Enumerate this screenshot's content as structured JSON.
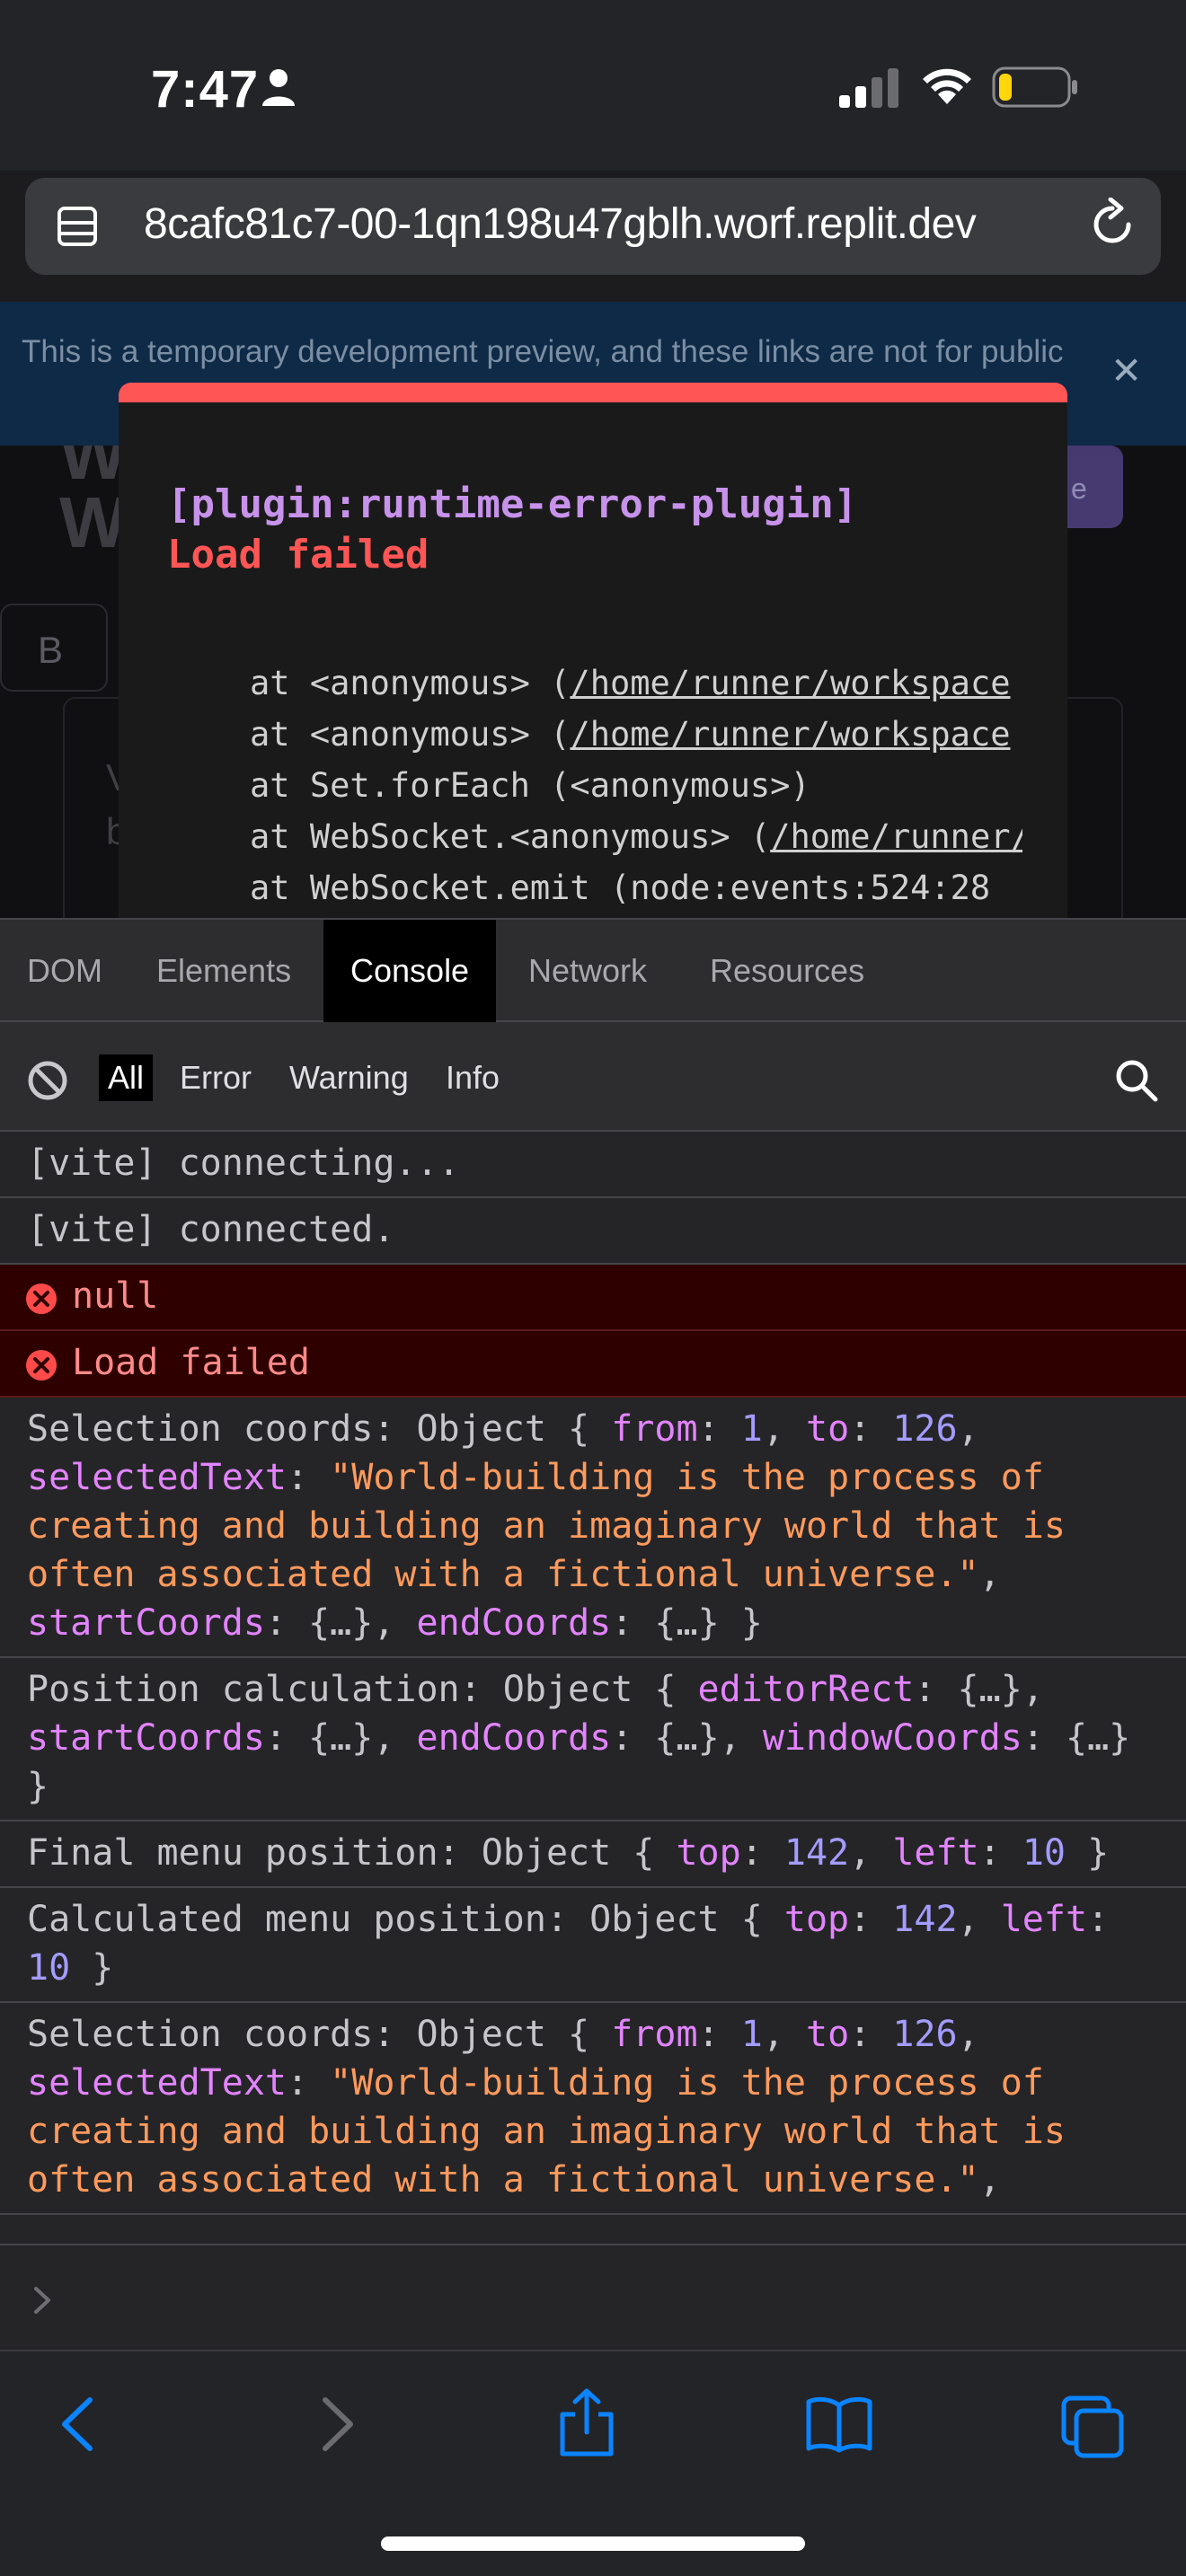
{
  "status_bar": {
    "time": "7:47",
    "battery_level": 0.2,
    "icons": [
      "person-icon",
      "cellular-signal-icon",
      "wifi-icon",
      "battery-icon"
    ]
  },
  "address_bar": {
    "url": "8cafc81c7-00-1qn198u47gblh.worf.replit.dev",
    "icons": [
      "tab-overview-icon",
      "reload-icon"
    ]
  },
  "page": {
    "banner_text": "This is a temporary development preview, and these links are not for public",
    "banner_close": "✕",
    "bg_title": "W\nW",
    "bg_button": "e",
    "bg_b": "B",
    "bg_text": "V\nb"
  },
  "error_overlay": {
    "plugin": "[plugin:runtime-error-plugin]",
    "message": "Load failed",
    "stack": [
      {
        "prefix": "at <anonymous> (",
        "link": "/home/runner/workspace",
        "suffix": ""
      },
      {
        "prefix": "at <anonymous> (",
        "link": "/home/runner/workspace",
        "suffix": ""
      },
      {
        "prefix": "at Set.forEach (<anonymous>)",
        "link": "",
        "suffix": ""
      },
      {
        "prefix": "at WebSocket.<anonymous> (",
        "link": "/home/runner/",
        "suffix": ""
      },
      {
        "prefix": "at WebSocket.emit (node:events:524:28",
        "link": "",
        "suffix": ""
      }
    ]
  },
  "devtools": {
    "tabs": [
      {
        "label": "DOM",
        "active": false
      },
      {
        "label": "Elements",
        "active": false
      },
      {
        "label": "Console",
        "active": true
      },
      {
        "label": "Network",
        "active": false
      },
      {
        "label": "Resources",
        "active": false
      }
    ],
    "filters": [
      {
        "label": "All",
        "active": true
      },
      {
        "label": "Error",
        "active": false
      },
      {
        "label": "Warning",
        "active": false
      },
      {
        "label": "Info",
        "active": false
      }
    ]
  },
  "console_messages": [
    {
      "level": "log",
      "text": "[vite] connecting..."
    },
    {
      "level": "log",
      "text": "[vite] connected."
    },
    {
      "level": "error",
      "text": "null"
    },
    {
      "level": "error",
      "text": "Load failed"
    },
    {
      "level": "log",
      "label": "Selection coords: Object { ",
      "props": [
        {
          "key": "from",
          "value": "1",
          "kind": "n"
        },
        {
          "key": "to",
          "value": "126",
          "kind": "n"
        },
        {
          "key": "selectedText",
          "value": "\"World-building is the process of creating and building an imaginary world that is often associated with a fictional universe.\"",
          "kind": "s"
        },
        {
          "key": "startCoords",
          "value": "{…}",
          "kind": "o"
        },
        {
          "key": "endCoords",
          "value": "{…}",
          "kind": "o"
        }
      ],
      "close": " }"
    },
    {
      "level": "log",
      "label": "Position calculation: Object { ",
      "props": [
        {
          "key": "editorRect",
          "value": "{…}",
          "kind": "o"
        },
        {
          "key": "startCoords",
          "value": "{…}",
          "kind": "o"
        },
        {
          "key": "endCoords",
          "value": "{…}",
          "kind": "o"
        },
        {
          "key": "windowCoords",
          "value": "{…}",
          "kind": "o"
        }
      ],
      "close": " }"
    },
    {
      "level": "log",
      "label": "Final menu position: Object { ",
      "props": [
        {
          "key": "top",
          "value": "142",
          "kind": "n"
        },
        {
          "key": "left",
          "value": "10",
          "kind": "n"
        }
      ],
      "close": " }"
    },
    {
      "level": "log",
      "label": "Calculated menu position: Object { ",
      "props": [
        {
          "key": "top",
          "value": "142",
          "kind": "n"
        },
        {
          "key": "left",
          "value": "10",
          "kind": "n"
        }
      ],
      "close": " }"
    },
    {
      "level": "log",
      "label": "Selection coords: Object { ",
      "props": [
        {
          "key": "from",
          "value": "1",
          "kind": "n"
        },
        {
          "key": "to",
          "value": "126",
          "kind": "n"
        },
        {
          "key": "selectedText",
          "value": "\"World-building is the process of creating and building an imaginary world that is often associated with a fictional universe.\"",
          "kind": "s"
        }
      ],
      "close": ""
    }
  ],
  "toolbar": {
    "icons": [
      "back-icon",
      "forward-icon",
      "share-icon",
      "bookmarks-icon",
      "tabs-icon"
    ]
  },
  "colors": {
    "error_bar": "#ff5555",
    "plugin": "#c792ea",
    "key": "#e384ff",
    "number": "#a49cff",
    "string": "#ff9a5c",
    "ios_blue": "#0a84ff"
  }
}
